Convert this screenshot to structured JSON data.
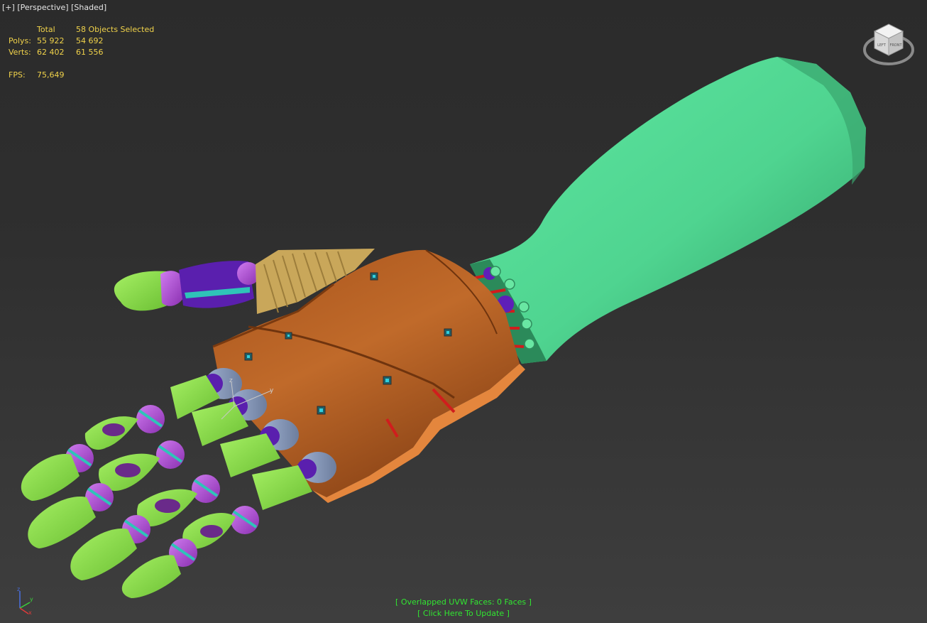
{
  "viewport": {
    "labels": {
      "plus": "[+]",
      "view": "[Perspective]",
      "shading": "[Shaded]"
    },
    "stats": {
      "header_total": "Total",
      "header_selected": "58 Objects Selected",
      "polys_label": "Polys:",
      "polys_total": "55 922",
      "polys_selected": "54 692",
      "verts_label": "Verts:",
      "verts_total": "62 402",
      "verts_selected": "61 556",
      "fps_label": "FPS:",
      "fps_value": "75,649"
    },
    "uvw": {
      "status": "[ Overlapped UVW Faces: 0 Faces ]",
      "update": "[ Click Here To Update ]"
    },
    "viewcube": {
      "left": "LEFT",
      "front": "FRONT"
    },
    "axes": {
      "x": "x",
      "y": "y",
      "z": "z"
    }
  },
  "colors": {
    "background": "#2f2f2f",
    "stats_text": "#f0d24a",
    "uvw_text": "#31e631",
    "forearm": "#4fd88f",
    "palm": "#b35f22",
    "fingertips": "#8ee04a",
    "joints_violet": "#b44fd6",
    "joints_purple": "#5a1fae",
    "thumb_guard": "#c9a75a",
    "tendons": "#d01d1d"
  }
}
